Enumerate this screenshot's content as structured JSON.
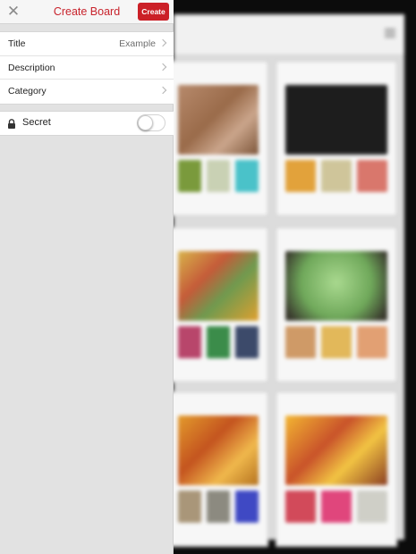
{
  "header": {
    "close_icon": "close-icon",
    "title": "Create Board",
    "create_label": "Create"
  },
  "fields": [
    {
      "label": "Title",
      "value": "Example"
    },
    {
      "label": "Description",
      "value": ""
    },
    {
      "label": "Category",
      "value": ""
    }
  ],
  "secret": {
    "icon": "lock-icon",
    "label": "Secret",
    "enabled": false
  },
  "colors": {
    "accent": "#cb2027",
    "title_red": "#c8232c",
    "panel_bg": "#e2e2e2"
  }
}
